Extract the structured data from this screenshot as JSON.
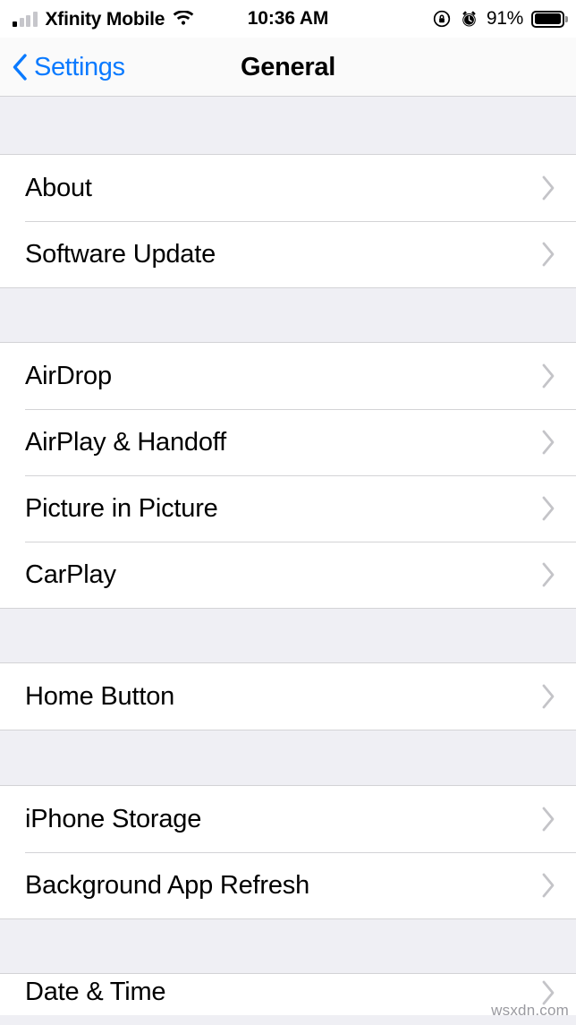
{
  "status_bar": {
    "carrier": "Xfinity Mobile",
    "signal_bars_total": 4,
    "signal_bars_filled": 1,
    "wifi_icon": "wifi-icon",
    "time": "10:36 AM",
    "rotation_lock_icon": "rotation-lock-icon",
    "alarm_icon": "alarm-clock-icon",
    "battery_percent": "91%",
    "battery_icon": "battery-icon",
    "battery_level": 91
  },
  "nav_bar": {
    "back_label": "Settings",
    "back_icon": "chevron-left-icon",
    "title": "General"
  },
  "colors": {
    "accent_blue": "#0A7AFF",
    "group_background": "#EFEFF4",
    "cell_background": "#FFFFFF",
    "separator": "#D3D3D6",
    "chevron_gray": "#C4C4C8",
    "label_text": "#000000"
  },
  "sections": [
    {
      "id": "section-info",
      "rows": [
        {
          "label": "About",
          "accessory": "chevron-right-icon"
        },
        {
          "label": "Software Update",
          "accessory": "chevron-right-icon"
        }
      ]
    },
    {
      "id": "section-connectivity",
      "rows": [
        {
          "label": "AirDrop",
          "accessory": "chevron-right-icon"
        },
        {
          "label": "AirPlay & Handoff",
          "accessory": "chevron-right-icon"
        },
        {
          "label": "Picture in Picture",
          "accessory": "chevron-right-icon"
        },
        {
          "label": "CarPlay",
          "accessory": "chevron-right-icon"
        }
      ]
    },
    {
      "id": "section-hardware",
      "rows": [
        {
          "label": "Home Button",
          "accessory": "chevron-right-icon"
        }
      ]
    },
    {
      "id": "section-storage",
      "rows": [
        {
          "label": "iPhone Storage",
          "accessory": "chevron-right-icon"
        },
        {
          "label": "Background App Refresh",
          "accessory": "chevron-right-icon"
        }
      ]
    },
    {
      "id": "section-datetime",
      "partial": true,
      "rows": [
        {
          "label": "Date & Time",
          "accessory": "chevron-right-icon"
        }
      ]
    }
  ],
  "watermark": "wsxdn.com"
}
